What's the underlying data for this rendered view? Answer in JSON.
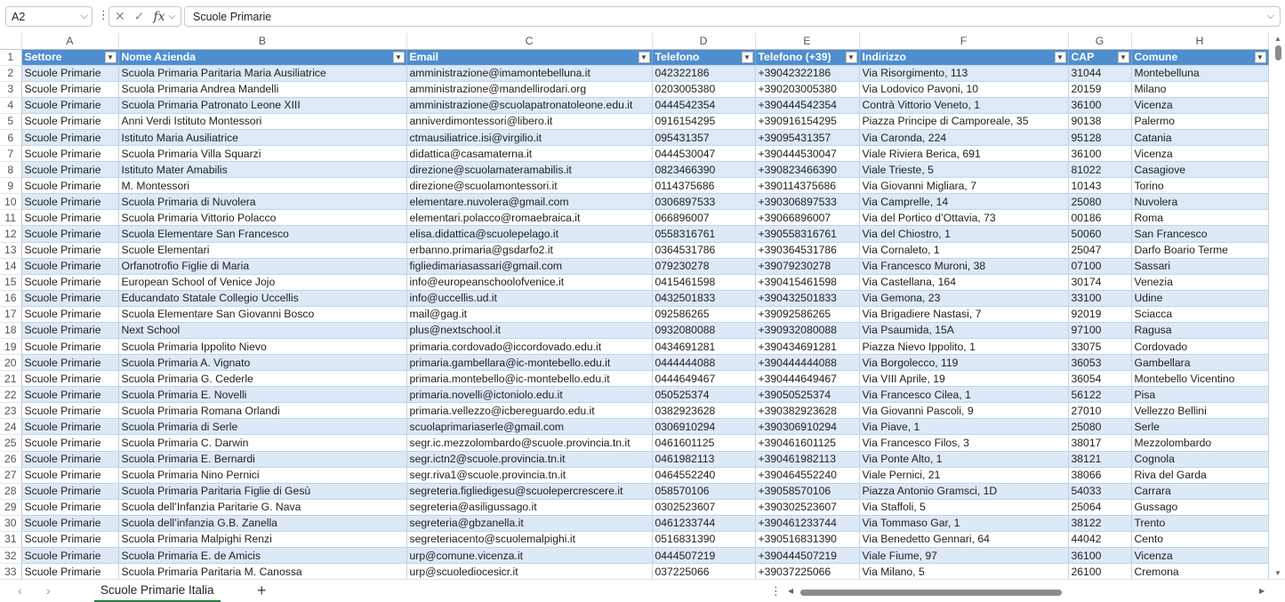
{
  "formula_bar": {
    "name_box": "A2",
    "fx_label": "fx",
    "formula_value": "Scuole Primarie"
  },
  "column_letters": [
    "A",
    "B",
    "C",
    "D",
    "E",
    "F",
    "G",
    "H"
  ],
  "headers": [
    "Settore",
    "Nome Azienda",
    "Email",
    "Telefono",
    "Telefono (+39)",
    "Indirizzo",
    "CAP",
    "Comune"
  ],
  "rows": [
    [
      "Scuole Primarie",
      "Scuola Primaria Paritaria Maria Ausiliatrice",
      "amministrazione@imamontebelluna.it",
      "042322186",
      "+39042322186",
      "Via Risorgimento, 113",
      "31044",
      "Montebelluna"
    ],
    [
      "Scuole Primarie",
      "Scuola Primaria Andrea Mandelli",
      "amministrazione@mandellirodari.org",
      "0203005380",
      "+390203005380",
      "Via Lodovico Pavoni, 10",
      "20159",
      "Milano"
    ],
    [
      "Scuole Primarie",
      "Scuola Primaria Patronato Leone XIII",
      "amministrazione@scuolapatronatoleone.edu.it",
      "0444542354",
      "+390444542354",
      "Contrà Vittorio Veneto, 1",
      "36100",
      "Vicenza"
    ],
    [
      "Scuole Primarie",
      "Anni Verdi Istituto Montessori",
      "anniverdimontessori@libero.it",
      "0916154295",
      "+390916154295",
      "Piazza Principe di Camporeale, 35",
      "90138",
      "Palermo"
    ],
    [
      "Scuole Primarie",
      "Istituto Maria Ausiliatrice",
      "ctmausiliatrice.isi@virgilio.it",
      "095431357",
      "+39095431357",
      "Via Caronda, 224",
      "95128",
      "Catania"
    ],
    [
      "Scuole Primarie",
      "Scuola Primaria Villa Squarzi",
      "didattica@casamaterna.it",
      "0444530047",
      "+390444530047",
      "Viale Riviera Berica, 691",
      "36100",
      "Vicenza"
    ],
    [
      "Scuole Primarie",
      "Istituto Mater Amabilis",
      "direzione@scuolamateramabilis.it",
      "0823466390",
      "+390823466390",
      "Viale Trieste, 5",
      "81022",
      "Casagiove"
    ],
    [
      "Scuole Primarie",
      "M. Montessori",
      "direzione@scuolamontessori.it",
      "0114375686",
      "+390114375686",
      "Via Giovanni Migliara, 7",
      "10143",
      "Torino"
    ],
    [
      "Scuole Primarie",
      "Scuola Primaria di Nuvolera",
      "elementare.nuvolera@gmail.com",
      "0306897533",
      "+390306897533",
      "Via Camprelle, 14",
      "25080",
      "Nuvolera"
    ],
    [
      "Scuole Primarie",
      "Scuola Primaria Vittorio Polacco",
      "elementari.polacco@romaebraica.it",
      "066896007",
      "+39066896007",
      "Via del Portico d’Ottavia, 73",
      "00186",
      "Roma"
    ],
    [
      "Scuole Primarie",
      "Scuola Elementare San Francesco",
      "elisa.didattica@scuolepelago.it",
      "0558316761",
      "+390558316761",
      "Via del Chiostro, 1",
      "50060",
      "San Francesco"
    ],
    [
      "Scuole Primarie",
      "Scuole Elementari",
      "erbanno.primaria@gsdarfo2.it",
      "0364531786",
      "+390364531786",
      "Via Cornaleto, 1",
      "25047",
      "Darfo Boario Terme"
    ],
    [
      "Scuole Primarie",
      "Orfanotrofio Figlie di Maria",
      "figliedimariasassari@gmail.com",
      "079230278",
      "+39079230278",
      "Via Francesco Muroni, 38",
      "07100",
      "Sassari"
    ],
    [
      "Scuole Primarie",
      "European School of Venice Jojo",
      "info@europeanschoolofvenice.it",
      "0415461598",
      "+390415461598",
      "Via Castellana, 164",
      "30174",
      "Venezia"
    ],
    [
      "Scuole Primarie",
      "Educandato Statale Collegio Uccellis",
      "info@uccellis.ud.it",
      "0432501833",
      "+390432501833",
      "Via Gemona, 23",
      "33100",
      "Udine"
    ],
    [
      "Scuole Primarie",
      "Scuola Elementare San Giovanni Bosco",
      "mail@gag.it",
      "092586265",
      "+39092586265",
      "Via Brigadiere Nastasi, 7",
      "92019",
      "Sciacca"
    ],
    [
      "Scuole Primarie",
      "Next School",
      "plus@nextschool.it",
      "0932080088",
      "+390932080088",
      "Via Psaumida, 15A",
      "97100",
      "Ragusa"
    ],
    [
      "Scuole Primarie",
      "Scuola Primaria Ippolito Nievo",
      "primaria.cordovado@iccordovado.edu.it",
      "0434691281",
      "+390434691281",
      "Piazza Nievo Ippolito, 1",
      "33075",
      "Cordovado"
    ],
    [
      "Scuole Primarie",
      "Scuola Primaria A. Vignato",
      "primaria.gambellara@ic-montebello.edu.it",
      "0444444088",
      "+390444444088",
      "Via Borgolecco, 119",
      "36053",
      "Gambellara"
    ],
    [
      "Scuole Primarie",
      "Scuola Primaria G. Cederle",
      "primaria.montebello@ic-montebello.edu.it",
      "0444649467",
      "+390444649467",
      "Via VIII Aprile, 19",
      "36054",
      "Montebello Vicentino"
    ],
    [
      "Scuole Primarie",
      "Scuola Primaria E. Novelli",
      "primaria.novelli@ictoniolo.edu.it",
      "050525374",
      "+39050525374",
      "Via Francesco Cilea, 1",
      "56122",
      "Pisa"
    ],
    [
      "Scuole Primarie",
      "Scuola Primaria Romana Orlandi",
      "primaria.vellezzo@icbereguardo.edu.it",
      "0382923628",
      "+390382923628",
      "Via Giovanni Pascoli, 9",
      "27010",
      "Vellezzo Bellini"
    ],
    [
      "Scuole Primarie",
      "Scuola Primaria di Serle",
      "scuolaprimariaserle@gmail.com",
      "0306910294",
      "+390306910294",
      "Via Piave, 1",
      "25080",
      "Serle"
    ],
    [
      "Scuole Primarie",
      "Scuola Primaria C. Darwin",
      "segr.ic.mezzolombardo@scuole.provincia.tn.it",
      "0461601125",
      "+390461601125",
      "Via Francesco Filos, 3",
      "38017",
      "Mezzolombardo"
    ],
    [
      "Scuole Primarie",
      "Scuola Primaria E. Bernardi",
      "segr.ictn2@scuole.provincia.tn.it",
      "0461982113",
      "+390461982113",
      "Via Ponte Alto, 1",
      "38121",
      "Cognola"
    ],
    [
      "Scuole Primarie",
      "Scuola Primaria Nino Pernici",
      "segr.riva1@scuole.provincia.tn.it",
      "0464552240",
      "+390464552240",
      "Viale Pernici, 21",
      "38066",
      "Riva del Garda"
    ],
    [
      "Scuole Primarie",
      "Scuola Primaria Paritaria Figlie di Gesù",
      "segreteria.figliedigesu@scuolepercrescere.it",
      "058570106",
      "+39058570106",
      "Piazza Antonio Gramsci, 1D",
      "54033",
      "Carrara"
    ],
    [
      "Scuole Primarie",
      "Scuola dell’Infanzia Paritarie G. Nava",
      "segreteria@asiligussago.it",
      "0302523607",
      "+390302523607",
      "Via Staffoli, 5",
      "25064",
      "Gussago"
    ],
    [
      "Scuole Primarie",
      "Scuola dell’infanzia G.B. Zanella",
      "segreteria@gbzanella.it",
      "0461233744",
      "+390461233744",
      "Via Tommaso Gar, 1",
      "38122",
      "Trento"
    ],
    [
      "Scuole Primarie",
      "Scuola Primaria Malpighi Renzi",
      "segreteriacento@scuolemalpighi.it",
      "0516831390",
      "+390516831390",
      "Via Benedetto Gennari, 64",
      "44042",
      "Cento"
    ],
    [
      "Scuole Primarie",
      "Scuola Primaria E. de Amicis",
      "urp@comune.vicenza.it",
      "0444507219",
      "+390444507219",
      "Viale Fiume, 97",
      "36100",
      "Vicenza"
    ],
    [
      "Scuole Primarie",
      "Scuola Primaria Paritaria M. Canossa",
      "urp@scuolediocesicr.it",
      "037225066",
      "+39037225066",
      "Via Milano, 5",
      "26100",
      "Cremona"
    ]
  ],
  "sheet_tabs": [
    "Scuole Primarie Italia"
  ],
  "icons": {
    "name_box_dropdown": "chevron-down-icon",
    "cancel": "close-icon",
    "confirm": "check-icon",
    "add_sheet": "plus-icon"
  },
  "colors": {
    "header_fill": "#4f8fd0",
    "band_fill": "#dde9f6",
    "active_tab_underline": "#1b7b3b"
  }
}
